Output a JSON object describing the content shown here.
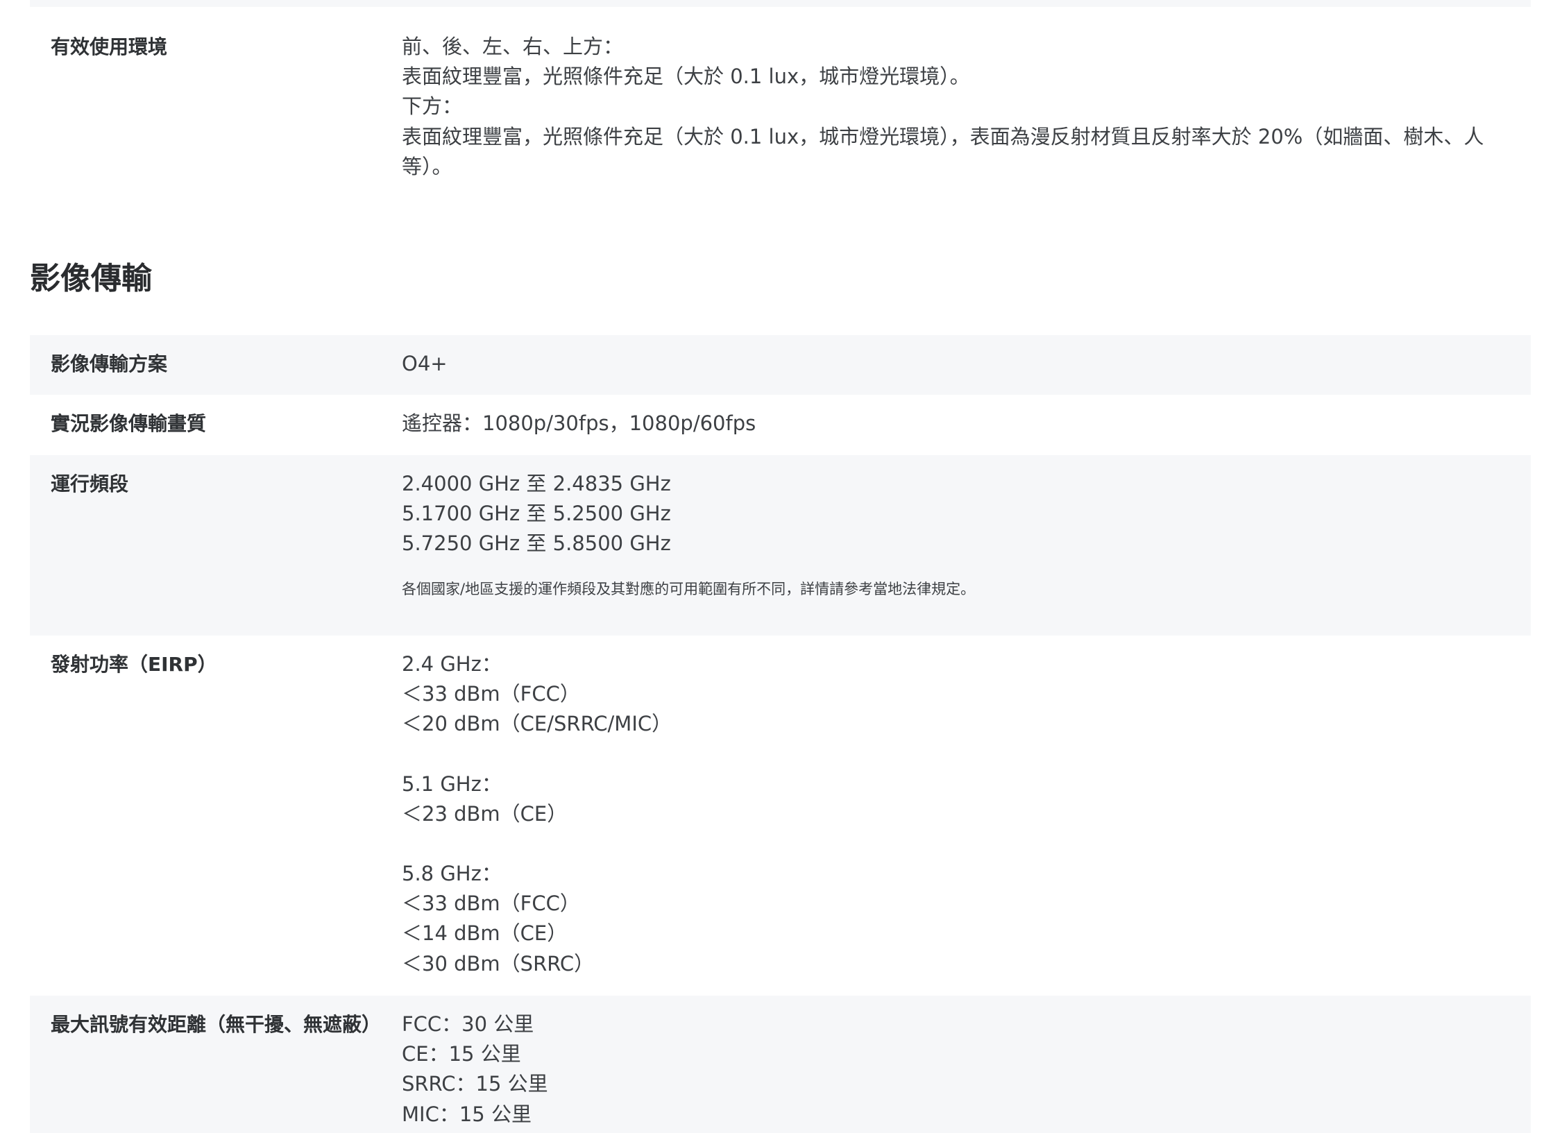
{
  "env": {
    "label": "有效使用環境",
    "lines": [
      "前、後、左、右、上方：",
      "表面紋理豐富，光照條件充足（大於 0.1 lux，城市燈光環境）。",
      "下方：",
      "表面紋理豐富，光照條件充足（大於 0.1 lux，城市燈光環境），表面為漫反射材質且反射率大於 20%（如牆面、樹木、人等）。"
    ]
  },
  "section": {
    "title": "影像傳輸"
  },
  "rows": [
    {
      "label": "影像傳輸方案",
      "lines": [
        "O4+"
      ]
    },
    {
      "label": "實況影像傳輸畫質",
      "lines": [
        "遙控器：1080p/30fps，1080p/60fps"
      ]
    },
    {
      "label": "運行頻段",
      "lines": [
        "2.4000 GHz 至 2.4835 GHz",
        "5.1700 GHz 至 5.2500 GHz",
        "5.7250 GHz 至 5.8500 GHz"
      ],
      "note": "各個國家/地區支援的運作頻段及其對應的可用範圍有所不同，詳情請參考當地法律規定。"
    },
    {
      "label": "發射功率（EIRP）",
      "groups": [
        [
          "2.4 GHz：",
          "＜33 dBm（FCC）",
          "＜20 dBm（CE/SRRC/MIC）"
        ],
        [
          "5.1 GHz：",
          "＜23 dBm（CE）"
        ],
        [
          "5.8 GHz：",
          "＜33 dBm（FCC）",
          "＜14 dBm（CE）",
          "＜30 dBm（SRRC）"
        ]
      ]
    },
    {
      "label": "最大訊號有效距離（無干擾、無遮蔽）",
      "lines": [
        "FCC：30 公里",
        "CE：15 公里",
        "SRRC：15 公里",
        "MIC：15 公里"
      ]
    }
  ]
}
